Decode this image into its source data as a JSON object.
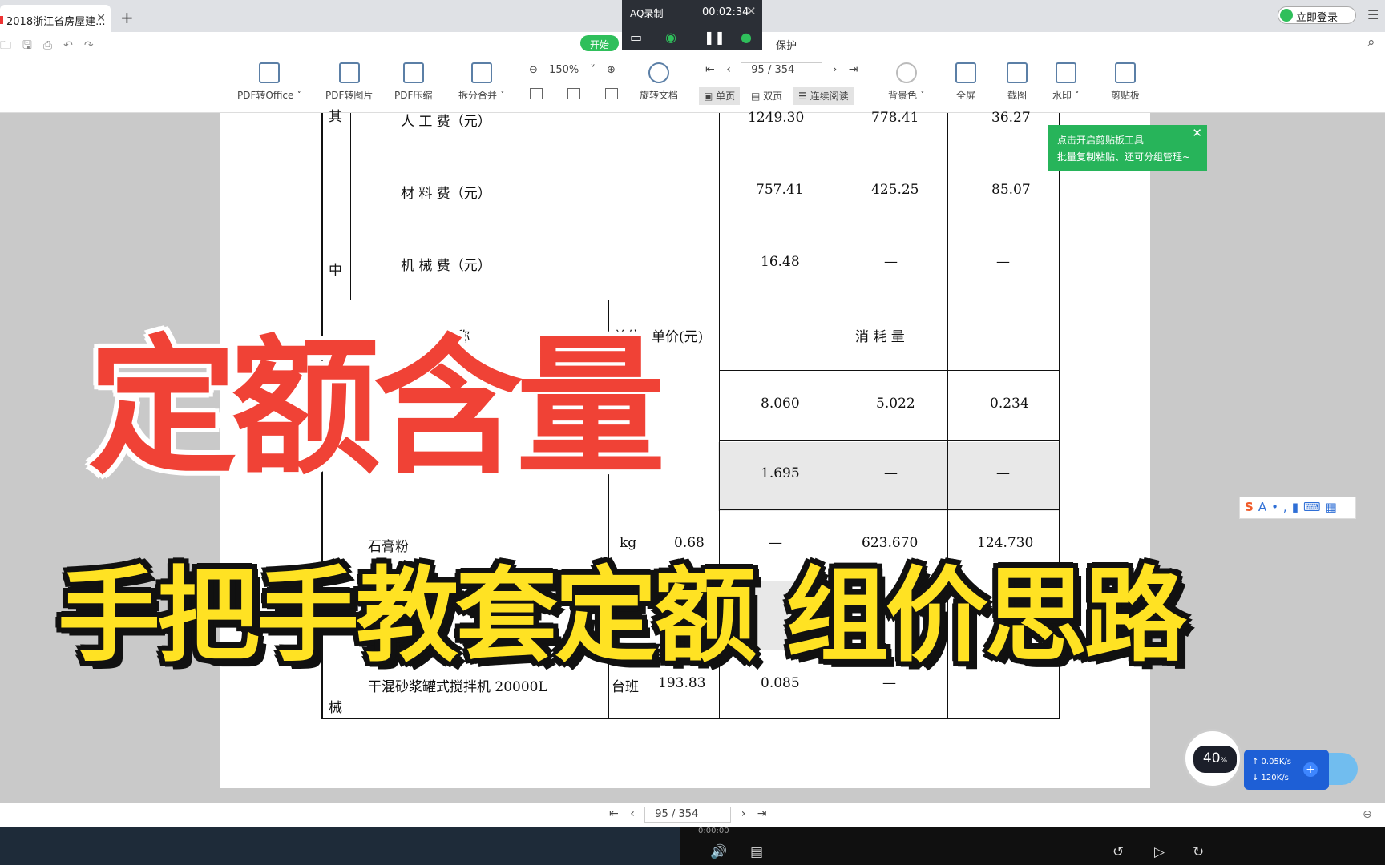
{
  "browser": {
    "tab_title": "2018浙江省房屋建...",
    "tab_close": "✕",
    "new_tab": "+",
    "login_label": "立即登录"
  },
  "quickbar": {
    "start_label": "开始",
    "protect_label": "保护"
  },
  "recorder": {
    "title": "AQ录制",
    "time": "00:02:34"
  },
  "toolbar": {
    "pdf_to_office": "PDF转Office ˅",
    "pdf_to_image": "PDF转图片",
    "pdf_compress": "PDF压缩",
    "split_merge": "拆分合并 ˅",
    "zoom": "150%",
    "rotate": "旋转文档",
    "page_current": "95",
    "page_total": "/ 354",
    "single_page": "单页",
    "double_page": "双页",
    "continuous": "连续阅读",
    "background": "背景色 ˅",
    "fullscreen": "全屏",
    "screenshot": "截图",
    "watermark": "水印 ˅",
    "clipboard": "剪贴板"
  },
  "tooltip": {
    "line1": "点击开启剪贴板工具",
    "line2": "批量复制粘贴、还可分组管理~"
  },
  "document": {
    "rows_top": [
      {
        "label": "人    工    费（元）",
        "v1": "1249.30",
        "v2": "778.41",
        "v3": "36.27"
      },
      {
        "label": "材    料    费（元）",
        "v1": "757.41",
        "v2": "425.25",
        "v3": "85.07"
      },
      {
        "label": "机    械    费（元）",
        "v1": "16.48",
        "v2": "—",
        "v3": "—"
      }
    ],
    "side_top": "中",
    "side_cut": "其",
    "header": {
      "name": "名    称",
      "unit": "单位",
      "price": "单价(元)",
      "consumption": "消  耗  量"
    },
    "rows_bottom": [
      {
        "name": "",
        "unit": "",
        "price": "",
        "v1": "8.060",
        "v2": "5.022",
        "v3": "0.234"
      },
      {
        "name": "",
        "unit": "",
        "price": "",
        "v1": "1.695",
        "v2": "—",
        "v3": "—"
      },
      {
        "name": "石膏粉",
        "unit": "kg",
        "price": "0.68",
        "v1": "—",
        "v2": "623.670",
        "v3": "124.730"
      },
      {
        "name": "干混砂浆罐式搅拌机 20000L",
        "unit": "台班",
        "price": "193.83",
        "v1": "0.085",
        "v2": "—",
        "v3": ""
      }
    ],
    "side_bottom": "械"
  },
  "overlay": {
    "title_red": "定额含量",
    "title_yellow": "手把手教套定额  组价思路"
  },
  "speed_widget": {
    "percent": "40",
    "percent_unit": "%",
    "upload": "↑ 0.05K/s",
    "download": "↓ 120K/s"
  },
  "bottom_nav": {
    "page_current": "95",
    "page_total": "/ 354"
  },
  "player": {
    "time_partial": "0:00:00"
  }
}
